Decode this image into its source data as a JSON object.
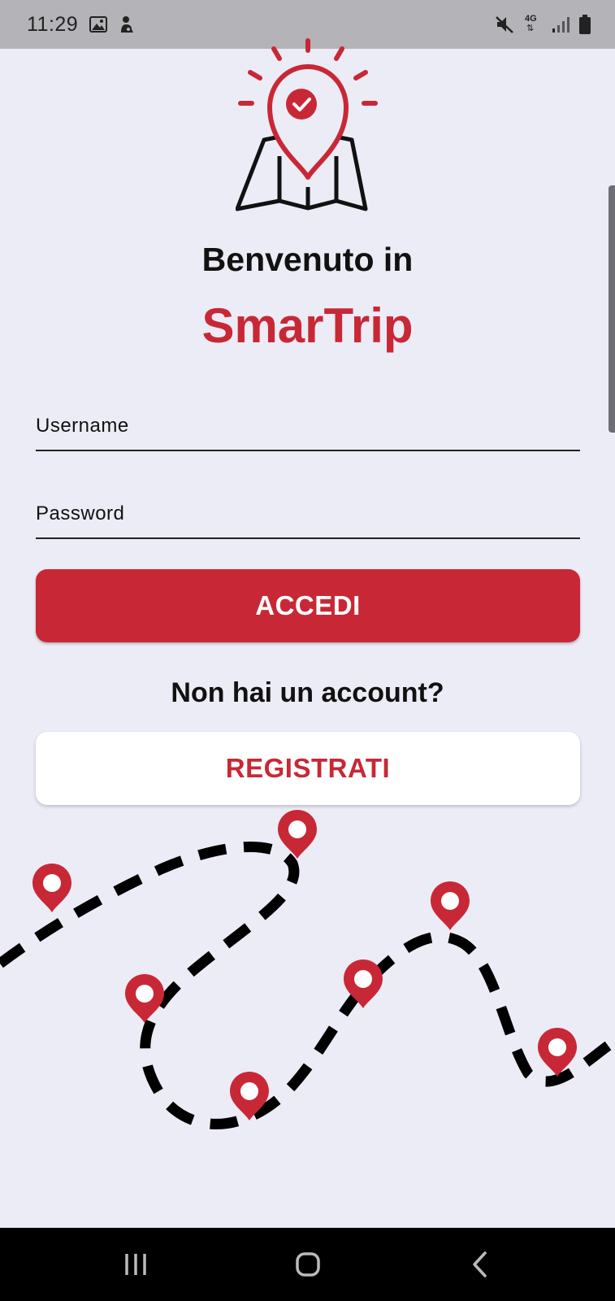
{
  "status_bar": {
    "time": "11:29",
    "network": "4G",
    "icons": [
      "image-icon",
      "notification-icon",
      "mute-icon",
      "network-icon",
      "signal-icon",
      "battery-icon"
    ]
  },
  "welcome_text": "Benvenuto in",
  "brand_name": "SmarTrip",
  "form": {
    "username_placeholder": "Username",
    "password_placeholder": "Password"
  },
  "login_button": "ACCEDI",
  "no_account_text": "Non hai un account?",
  "register_button": "REGISTRATI",
  "colors": {
    "accent": "#c82836",
    "background": "#ececf6",
    "text": "#111111"
  },
  "nav_bar": {
    "icons": [
      "recent-apps-icon",
      "home-icon",
      "back-icon"
    ]
  }
}
